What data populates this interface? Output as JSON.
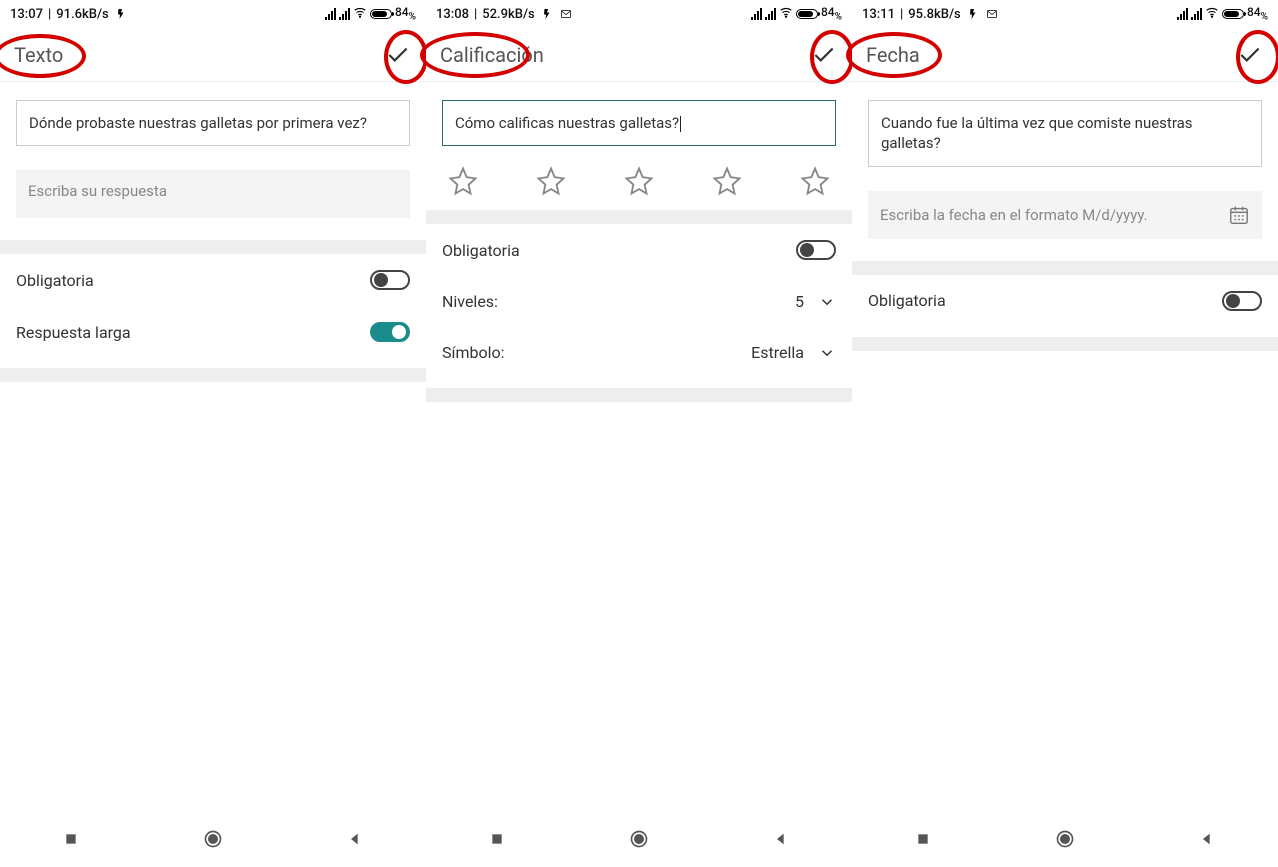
{
  "screens": [
    {
      "status": {
        "time": "13:07",
        "net": "91.6kB/s",
        "flash": true,
        "gmail": false,
        "battery_pct": "84",
        "pct_suffix": "%"
      },
      "header": {
        "title": "Texto"
      },
      "question": "Dónde probaste nuestras galletas por primera vez?",
      "question_active": false,
      "answer_placeholder": "Escriba su respuesta",
      "settings": {
        "obligatoria_label": "Obligatoria",
        "obligatoria_on": false,
        "respuesta_larga_label": "Respuesta larga",
        "respuesta_larga_on": true
      }
    },
    {
      "status": {
        "time": "13:08",
        "net": "52.9kB/s",
        "flash": true,
        "gmail": true,
        "battery_pct": "84",
        "pct_suffix": "%"
      },
      "header": {
        "title": "Calificación"
      },
      "question": "Cómo calificas nuestras galletas?",
      "question_active": true,
      "stars": 5,
      "settings": {
        "obligatoria_label": "Obligatoria",
        "obligatoria_on": false,
        "niveles_label": "Niveles:",
        "niveles_value": "5",
        "simbolo_label": "Símbolo:",
        "simbolo_value": "Estrella"
      }
    },
    {
      "status": {
        "time": "13:11",
        "net": "95.8kB/s",
        "flash": true,
        "gmail": true,
        "battery_pct": "84",
        "pct_suffix": "%"
      },
      "header": {
        "title": "Fecha"
      },
      "question": "Cuando fue la última vez que comiste nuestras galletas?",
      "question_active": false,
      "date_placeholder": "Escriba la fecha en el formato M/d/yyyy.",
      "settings": {
        "obligatoria_label": "Obligatoria",
        "obligatoria_on": false
      }
    }
  ],
  "annotations": {
    "title_ellipse": true,
    "check_ellipse": true
  }
}
